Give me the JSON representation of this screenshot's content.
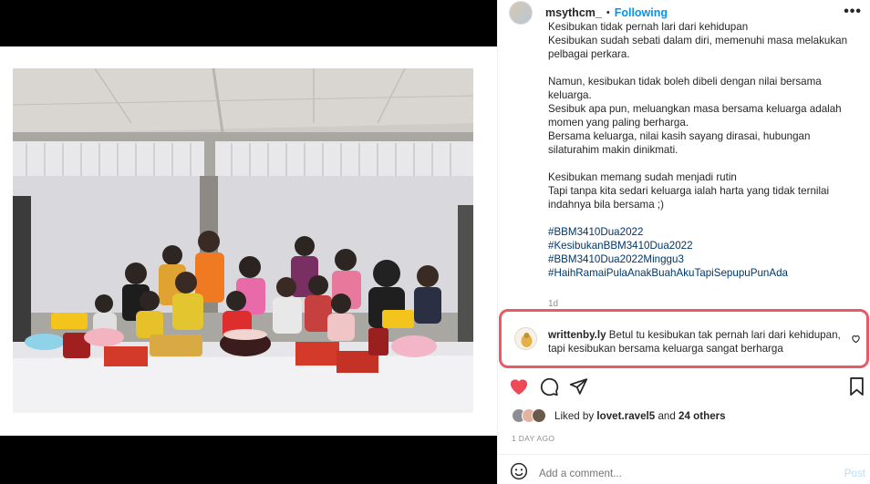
{
  "post": {
    "username": "msythcm_",
    "separator": "•",
    "follow_status": "Following",
    "more_glyph": "•••",
    "caption_paragraphs": [
      [
        "Kesibukan tidak pernah lari dari kehidupan",
        "Kesibukan sudah sebati dalam diri, memenuhi masa melakukan pelbagai perkara."
      ],
      [
        "Namun, kesibukan tidak boleh dibeli dengan nilai bersama keluarga.",
        "Sesibuk apa pun, meluangkan masa bersama keluarga adalah momen yang paling berharga.",
        "Bersama keluarga, nilai kasih sayang dirasai, hubungan silaturahim makin dinikmati."
      ],
      [
        "Kesibukan memang sudah menjadi rutin",
        "Tapi tanpa kita sedari keluarga ialah harta yang tidak ternilai indahnya bila bersama ;)"
      ]
    ],
    "hashtags": [
      "#BBM3410Dua2022",
      "#KesibukanBBM3410Dua2022",
      "#BBM3410Dua2022Minggu3",
      "#HaihRamaiPulaAnakBuahAkuTapiSepupuPunAda"
    ],
    "caption_time": "1d"
  },
  "comment": {
    "username": "writtenby.ly",
    "text": "Betul tu kesibukan tak pernah lari dari kehidupan, tapi kesibukan bersama keluarga sangat berharga"
  },
  "likes": {
    "prefix": "Liked by",
    "first_liker": "lovet.ravel5",
    "connector": "and",
    "others": "24 others"
  },
  "timestamp": "1 DAY AGO",
  "add_comment": {
    "placeholder": "Add a comment...",
    "post_label": "Post"
  },
  "colors": {
    "accent_blue": "#0095f6",
    "heart_red": "#ed4956",
    "highlight_border": "#e85a66",
    "hashtag": "#00376b"
  },
  "icons": {
    "like": "heart-icon",
    "comment": "comment-icon",
    "share": "paper-plane-icon",
    "save": "bookmark-icon",
    "emoji": "smiley-icon"
  }
}
